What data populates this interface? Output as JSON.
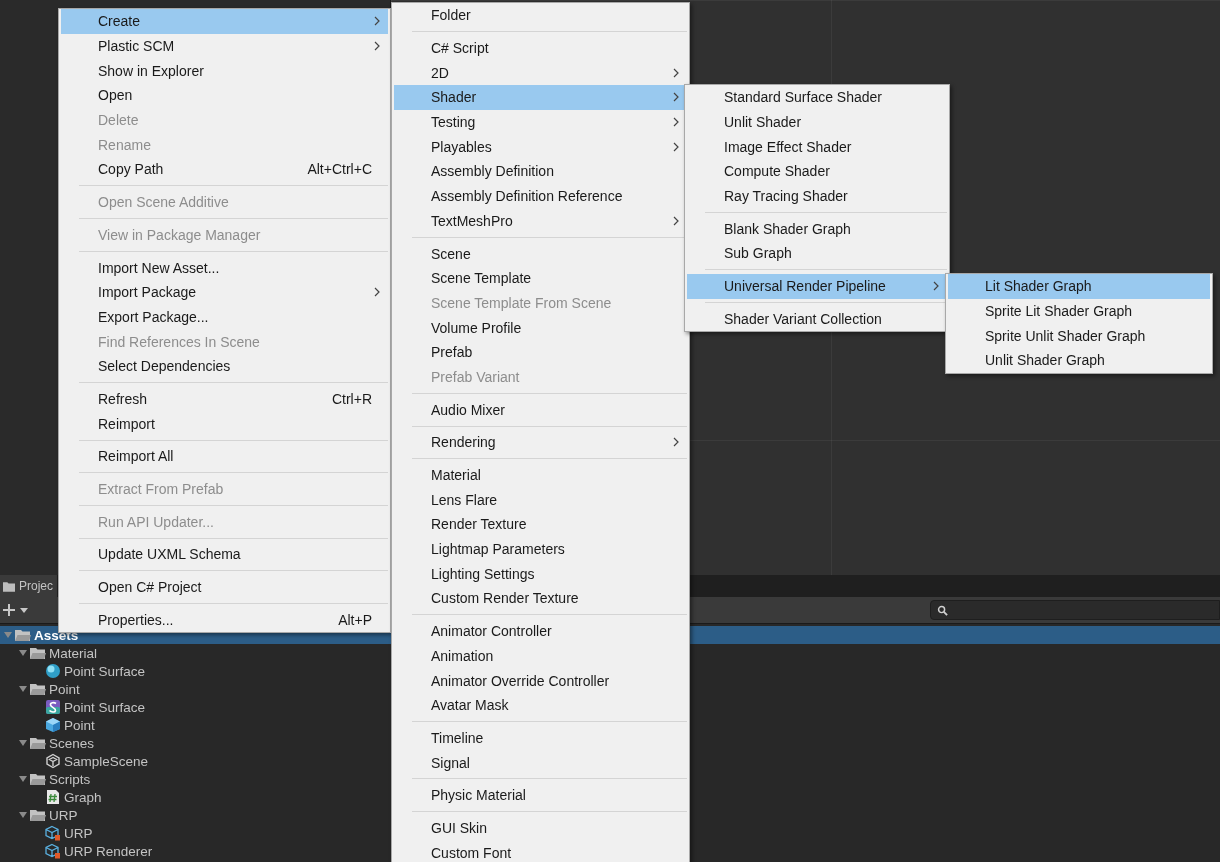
{
  "menus": [
    {
      "items": [
        {
          "kind": "item",
          "label": "Create",
          "submenu": true,
          "disabled": false,
          "selected": true
        },
        {
          "kind": "item",
          "label": "Plastic SCM",
          "submenu": true,
          "disabled": false,
          "selected": false
        },
        {
          "kind": "item",
          "label": "Show in Explorer",
          "submenu": false,
          "disabled": false,
          "selected": false
        },
        {
          "kind": "item",
          "label": "Open",
          "submenu": false,
          "disabled": false,
          "selected": false
        },
        {
          "kind": "item",
          "label": "Delete",
          "submenu": false,
          "disabled": true,
          "selected": false
        },
        {
          "kind": "item",
          "label": "Rename",
          "submenu": false,
          "disabled": true,
          "selected": false
        },
        {
          "kind": "item",
          "label": "Copy Path",
          "shortcut": "Alt+Ctrl+C",
          "submenu": false,
          "disabled": false,
          "selected": false
        },
        {
          "kind": "separator"
        },
        {
          "kind": "item",
          "label": "Open Scene Additive",
          "submenu": false,
          "disabled": true,
          "selected": false
        },
        {
          "kind": "separator"
        },
        {
          "kind": "item",
          "label": "View in Package Manager",
          "submenu": false,
          "disabled": true,
          "selected": false
        },
        {
          "kind": "separator"
        },
        {
          "kind": "item",
          "label": "Import New Asset...",
          "submenu": false,
          "disabled": false,
          "selected": false
        },
        {
          "kind": "item",
          "label": "Import Package",
          "submenu": true,
          "disabled": false,
          "selected": false
        },
        {
          "kind": "item",
          "label": "Export Package...",
          "submenu": false,
          "disabled": false,
          "selected": false
        },
        {
          "kind": "item",
          "label": "Find References In Scene",
          "submenu": false,
          "disabled": true,
          "selected": false
        },
        {
          "kind": "item",
          "label": "Select Dependencies",
          "submenu": false,
          "disabled": false,
          "selected": false
        },
        {
          "kind": "separator"
        },
        {
          "kind": "item",
          "label": "Refresh",
          "shortcut": "Ctrl+R",
          "submenu": false,
          "disabled": false,
          "selected": false
        },
        {
          "kind": "item",
          "label": "Reimport",
          "submenu": false,
          "disabled": false,
          "selected": false
        },
        {
          "kind": "separator"
        },
        {
          "kind": "item",
          "label": "Reimport All",
          "submenu": false,
          "disabled": false,
          "selected": false
        },
        {
          "kind": "separator"
        },
        {
          "kind": "item",
          "label": "Extract From Prefab",
          "submenu": false,
          "disabled": true,
          "selected": false
        },
        {
          "kind": "separator"
        },
        {
          "kind": "item",
          "label": "Run API Updater...",
          "submenu": false,
          "disabled": true,
          "selected": false
        },
        {
          "kind": "separator"
        },
        {
          "kind": "item",
          "label": "Update UXML Schema",
          "submenu": false,
          "disabled": false,
          "selected": false
        },
        {
          "kind": "separator"
        },
        {
          "kind": "item",
          "label": "Open C# Project",
          "submenu": false,
          "disabled": false,
          "selected": false
        },
        {
          "kind": "separator"
        },
        {
          "kind": "item",
          "label": "Properties...",
          "shortcut": "Alt+P",
          "submenu": false,
          "disabled": false,
          "selected": false
        }
      ]
    },
    {
      "items": [
        {
          "kind": "item",
          "label": "Folder",
          "submenu": false,
          "disabled": false,
          "selected": false
        },
        {
          "kind": "separator"
        },
        {
          "kind": "item",
          "label": "C# Script",
          "submenu": false,
          "disabled": false,
          "selected": false
        },
        {
          "kind": "item",
          "label": "2D",
          "submenu": true,
          "disabled": false,
          "selected": false
        },
        {
          "kind": "item",
          "label": "Shader",
          "submenu": true,
          "disabled": false,
          "selected": true
        },
        {
          "kind": "item",
          "label": "Testing",
          "submenu": true,
          "disabled": false,
          "selected": false
        },
        {
          "kind": "item",
          "label": "Playables",
          "submenu": true,
          "disabled": false,
          "selected": false
        },
        {
          "kind": "item",
          "label": "Assembly Definition",
          "submenu": false,
          "disabled": false,
          "selected": false
        },
        {
          "kind": "item",
          "label": "Assembly Definition Reference",
          "submenu": false,
          "disabled": false,
          "selected": false
        },
        {
          "kind": "item",
          "label": "TextMeshPro",
          "submenu": true,
          "disabled": false,
          "selected": false
        },
        {
          "kind": "separator"
        },
        {
          "kind": "item",
          "label": "Scene",
          "submenu": false,
          "disabled": false,
          "selected": false
        },
        {
          "kind": "item",
          "label": "Scene Template",
          "submenu": false,
          "disabled": false,
          "selected": false
        },
        {
          "kind": "item",
          "label": "Scene Template From Scene",
          "submenu": false,
          "disabled": true,
          "selected": false
        },
        {
          "kind": "item",
          "label": "Volume Profile",
          "submenu": false,
          "disabled": false,
          "selected": false
        },
        {
          "kind": "item",
          "label": "Prefab",
          "submenu": false,
          "disabled": false,
          "selected": false
        },
        {
          "kind": "item",
          "label": "Prefab Variant",
          "submenu": false,
          "disabled": true,
          "selected": false
        },
        {
          "kind": "separator"
        },
        {
          "kind": "item",
          "label": "Audio Mixer",
          "submenu": false,
          "disabled": false,
          "selected": false
        },
        {
          "kind": "separator"
        },
        {
          "kind": "item",
          "label": "Rendering",
          "submenu": true,
          "disabled": false,
          "selected": false
        },
        {
          "kind": "separator"
        },
        {
          "kind": "item",
          "label": "Material",
          "submenu": false,
          "disabled": false,
          "selected": false
        },
        {
          "kind": "item",
          "label": "Lens Flare",
          "submenu": false,
          "disabled": false,
          "selected": false
        },
        {
          "kind": "item",
          "label": "Render Texture",
          "submenu": false,
          "disabled": false,
          "selected": false
        },
        {
          "kind": "item",
          "label": "Lightmap Parameters",
          "submenu": false,
          "disabled": false,
          "selected": false
        },
        {
          "kind": "item",
          "label": "Lighting Settings",
          "submenu": false,
          "disabled": false,
          "selected": false
        },
        {
          "kind": "item",
          "label": "Custom Render Texture",
          "submenu": false,
          "disabled": false,
          "selected": false
        },
        {
          "kind": "separator"
        },
        {
          "kind": "item",
          "label": "Animator Controller",
          "submenu": false,
          "disabled": false,
          "selected": false
        },
        {
          "kind": "item",
          "label": "Animation",
          "submenu": false,
          "disabled": false,
          "selected": false
        },
        {
          "kind": "item",
          "label": "Animator Override Controller",
          "submenu": false,
          "disabled": false,
          "selected": false
        },
        {
          "kind": "item",
          "label": "Avatar Mask",
          "submenu": false,
          "disabled": false,
          "selected": false
        },
        {
          "kind": "separator"
        },
        {
          "kind": "item",
          "label": "Timeline",
          "submenu": false,
          "disabled": false,
          "selected": false
        },
        {
          "kind": "item",
          "label": "Signal",
          "submenu": false,
          "disabled": false,
          "selected": false
        },
        {
          "kind": "separator"
        },
        {
          "kind": "item",
          "label": "Physic Material",
          "submenu": false,
          "disabled": false,
          "selected": false
        },
        {
          "kind": "separator"
        },
        {
          "kind": "item",
          "label": "GUI Skin",
          "submenu": false,
          "disabled": false,
          "selected": false
        },
        {
          "kind": "item",
          "label": "Custom Font",
          "submenu": false,
          "disabled": false,
          "selected": false
        }
      ]
    },
    {
      "items": [
        {
          "kind": "item",
          "label": "Standard Surface Shader",
          "submenu": false,
          "disabled": false,
          "selected": false
        },
        {
          "kind": "item",
          "label": "Unlit Shader",
          "submenu": false,
          "disabled": false,
          "selected": false
        },
        {
          "kind": "item",
          "label": "Image Effect Shader",
          "submenu": false,
          "disabled": false,
          "selected": false
        },
        {
          "kind": "item",
          "label": "Compute Shader",
          "submenu": false,
          "disabled": false,
          "selected": false
        },
        {
          "kind": "item",
          "label": "Ray Tracing Shader",
          "submenu": false,
          "disabled": false,
          "selected": false
        },
        {
          "kind": "separator"
        },
        {
          "kind": "item",
          "label": "Blank Shader Graph",
          "submenu": false,
          "disabled": false,
          "selected": false
        },
        {
          "kind": "item",
          "label": "Sub Graph",
          "submenu": false,
          "disabled": false,
          "selected": false
        },
        {
          "kind": "separator"
        },
        {
          "kind": "item",
          "label": "Universal Render Pipeline",
          "submenu": true,
          "disabled": false,
          "selected": true
        },
        {
          "kind": "separator"
        },
        {
          "kind": "item",
          "label": "Shader Variant Collection",
          "submenu": false,
          "disabled": false,
          "selected": false
        }
      ]
    },
    {
      "items": [
        {
          "kind": "item",
          "label": "Lit Shader Graph",
          "submenu": false,
          "disabled": false,
          "selected": true
        },
        {
          "kind": "item",
          "label": "Sprite Lit Shader Graph",
          "submenu": false,
          "disabled": false,
          "selected": false
        },
        {
          "kind": "item",
          "label": "Sprite Unlit Shader Graph",
          "submenu": false,
          "disabled": false,
          "selected": false
        },
        {
          "kind": "item",
          "label": "Unlit Shader Graph",
          "submenu": false,
          "disabled": false,
          "selected": false
        }
      ]
    }
  ],
  "project": {
    "tab": "Projec",
    "tree": [
      {
        "label": "Assets",
        "kind": "folder",
        "expanded": true,
        "selected": true,
        "children": [
          {
            "label": "Material",
            "kind": "folder",
            "expanded": true,
            "selected": false,
            "children": [
              {
                "label": "Point Surface",
                "kind": "material",
                "selected": false
              }
            ]
          },
          {
            "label": "Point",
            "kind": "folder",
            "expanded": true,
            "selected": false,
            "children": [
              {
                "label": "Point Surface",
                "kind": "shader",
                "selected": false
              },
              {
                "label": "Point",
                "kind": "prefab",
                "selected": false
              }
            ]
          },
          {
            "label": "Scenes",
            "kind": "folder",
            "expanded": true,
            "selected": false,
            "children": [
              {
                "label": "SampleScene",
                "kind": "scene",
                "selected": false
              }
            ]
          },
          {
            "label": "Scripts",
            "kind": "folder",
            "expanded": true,
            "selected": false,
            "children": [
              {
                "label": "Graph",
                "kind": "script",
                "selected": false
              }
            ]
          },
          {
            "label": "URP",
            "kind": "folder",
            "expanded": true,
            "selected": false,
            "children": [
              {
                "label": "URP",
                "kind": "pipeline",
                "selected": false
              },
              {
                "label": "URP Renderer",
                "kind": "pipeline",
                "selected": false
              }
            ]
          }
        ]
      }
    ]
  }
}
